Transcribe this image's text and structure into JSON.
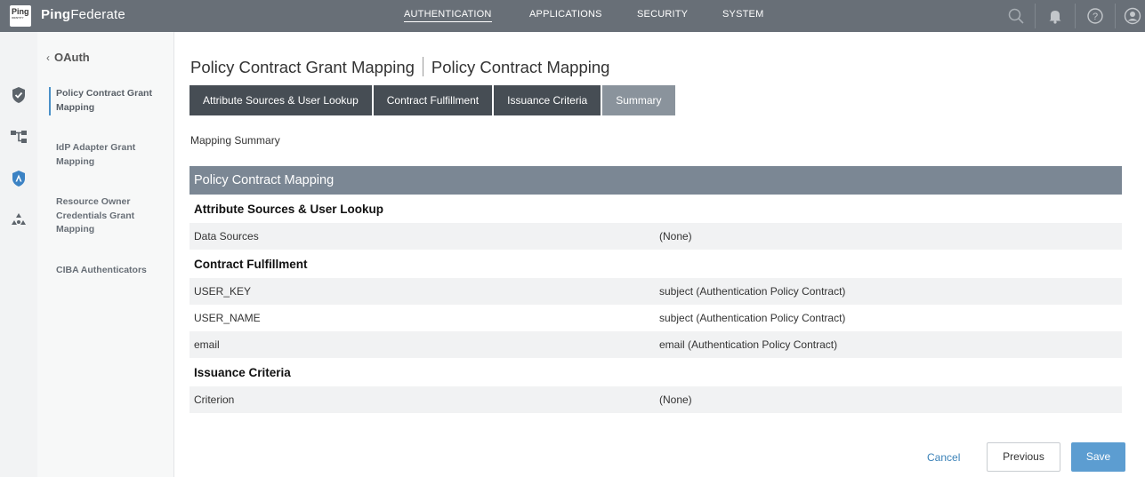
{
  "app": {
    "logo_text": "Ping",
    "logo_subtext": "IDENTITY",
    "brand_bold": "Ping",
    "brand_rest": "Federate"
  },
  "topnav": {
    "items": [
      {
        "label": "AUTHENTICATION",
        "active": true
      },
      {
        "label": "APPLICATIONS",
        "active": false
      },
      {
        "label": "SECURITY",
        "active": false
      },
      {
        "label": "SYSTEM",
        "active": false
      }
    ],
    "icons": [
      "search-icon",
      "bell-icon",
      "help-icon",
      "user-icon"
    ]
  },
  "rail": {
    "icons": [
      "shield-check-icon",
      "integration-icon",
      "oauth-badge-icon",
      "tokens-icon"
    ]
  },
  "subnav": {
    "back_label": "OAuth",
    "items": [
      {
        "label": "Policy Contract Grant Mapping",
        "active": true
      },
      {
        "label": "IdP Adapter Grant Mapping",
        "active": false
      },
      {
        "label": "Resource Owner Credentials Grant Mapping",
        "active": false
      },
      {
        "label": "CIBA Authenticators",
        "active": false
      }
    ]
  },
  "page": {
    "title_left": "Policy Contract Grant Mapping",
    "title_right": "Policy Contract Mapping",
    "tabs": [
      {
        "label": "Attribute Sources & User Lookup"
      },
      {
        "label": "Contract Fulfillment"
      },
      {
        "label": "Issuance Criteria"
      },
      {
        "label": "Summary",
        "current": true
      }
    ],
    "caption": "Mapping Summary"
  },
  "summary": {
    "header": "Policy Contract Mapping",
    "groups": [
      {
        "title": "Attribute Sources & User Lookup",
        "rows": [
          {
            "key": "Data Sources",
            "value": "(None)"
          }
        ]
      },
      {
        "title": "Contract Fulfillment",
        "rows": [
          {
            "key": "USER_KEY",
            "value": "subject (Authentication Policy Contract)"
          },
          {
            "key": "USER_NAME",
            "value": "subject (Authentication Policy Contract)"
          },
          {
            "key": "email",
            "value": "email (Authentication Policy Contract)"
          }
        ]
      },
      {
        "title": "Issuance Criteria",
        "rows": [
          {
            "key": "Criterion",
            "value": "(None)"
          }
        ]
      }
    ]
  },
  "footer": {
    "cancel_label": "Cancel",
    "previous_label": "Previous",
    "save_label": "Save"
  },
  "colors": {
    "topbar": "#686f77",
    "tab_dark": "#464d54",
    "tab_current": "#8a939c",
    "summary_header": "#7b8794",
    "accent_blue": "#5c9dd1"
  }
}
